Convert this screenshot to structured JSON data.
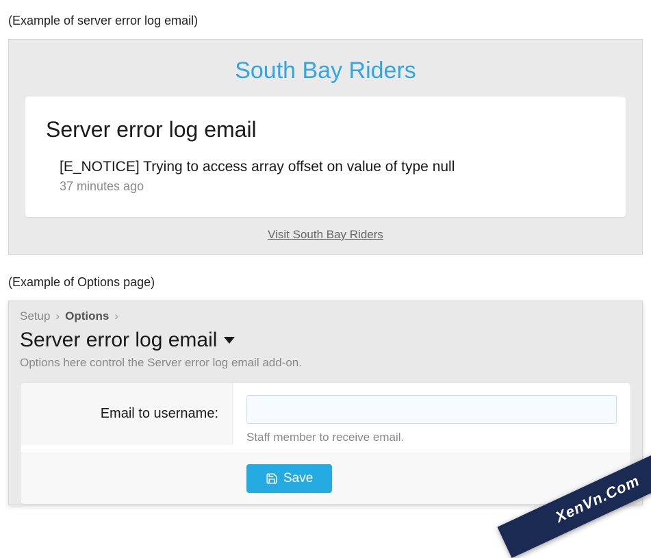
{
  "captions": {
    "email": "(Example of server error log email)",
    "options": "(Example of Options page)"
  },
  "email": {
    "site_title": "South Bay Riders",
    "heading": "Server error log email",
    "error_message": "[E_NOTICE] Trying to access array offset on value of type null",
    "time_ago": "37 minutes ago",
    "visit_link": "Visit South Bay Riders"
  },
  "options": {
    "breadcrumb": {
      "root": "Setup",
      "current": "Options"
    },
    "title": "Server error log email",
    "subtitle": "Options here control the Server error log email add-on.",
    "field_label": "Email to username:",
    "field_value": "",
    "field_hint": "Staff member to receive email.",
    "save_label": "Save"
  },
  "watermark": "XenVn.Com"
}
